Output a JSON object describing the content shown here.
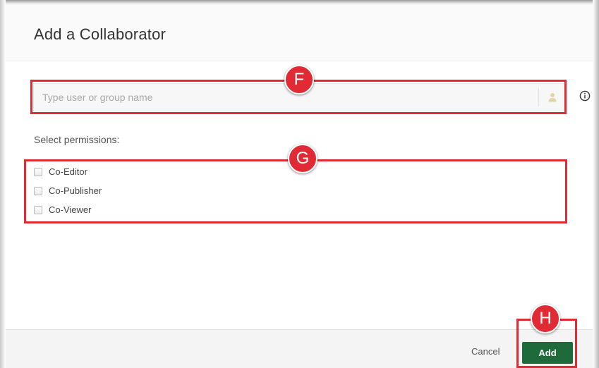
{
  "dialog": {
    "title": "Add a Collaborator"
  },
  "search": {
    "placeholder": "Type user or group name",
    "value": "",
    "trailing_icon": "person-icon"
  },
  "info": {
    "icon": "info-icon"
  },
  "permissions": {
    "label": "Select permissions:",
    "options": [
      {
        "label": "Co-Editor",
        "checked": false
      },
      {
        "label": "Co-Publisher",
        "checked": false
      },
      {
        "label": "Co-Viewer",
        "checked": false
      }
    ]
  },
  "footer": {
    "cancel_label": "Cancel",
    "add_label": "Add"
  },
  "annotations": [
    {
      "letter": "F",
      "target": "search-field"
    },
    {
      "letter": "G",
      "target": "permissions-list"
    },
    {
      "letter": "H",
      "target": "add-button"
    }
  ],
  "colors": {
    "annotation_red": "#e02b34",
    "primary_green": "#1f6a3b"
  }
}
